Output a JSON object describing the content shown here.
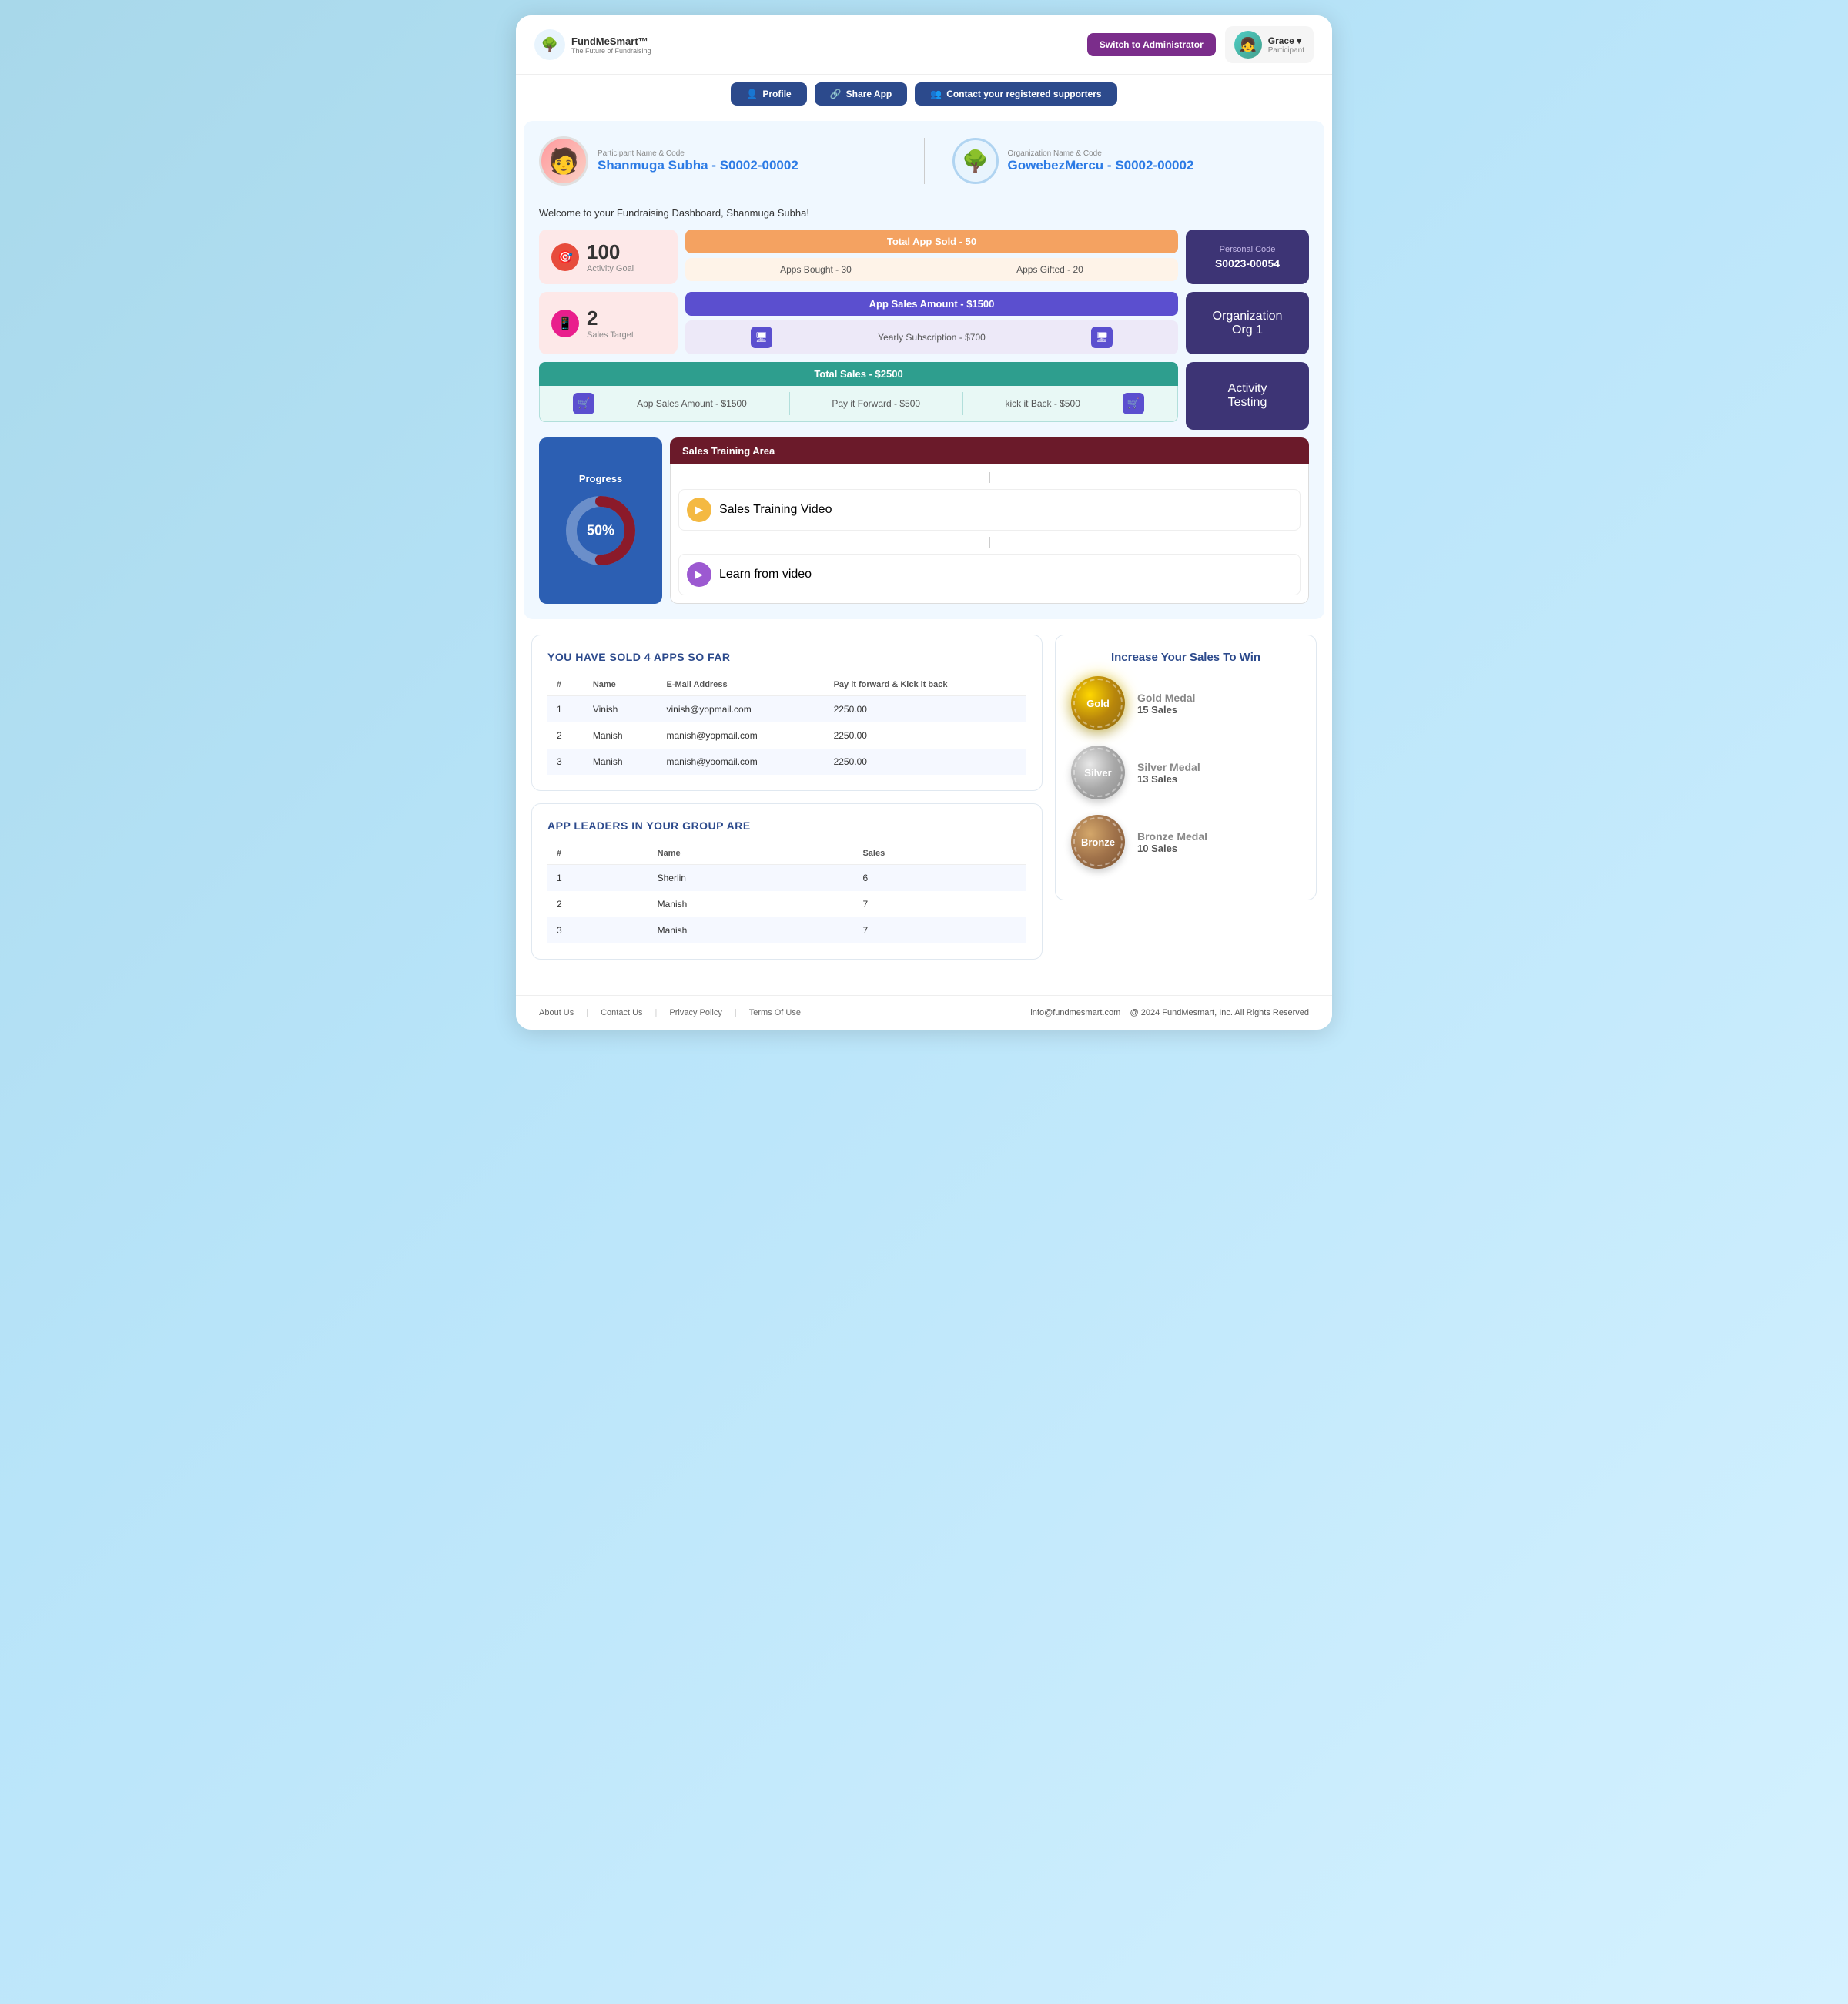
{
  "app": {
    "name": "FundMeSmart™",
    "tagline": "The Future of Fundraising"
  },
  "header": {
    "switch_btn": "Switch to Administrator",
    "user_name": "Grace",
    "user_chevron": "▾",
    "user_role": "Participant"
  },
  "nav": {
    "profile_label": "Profile",
    "share_label": "Share App",
    "contact_label": "Contact your registered supporters"
  },
  "participant": {
    "label": "Participant Name & Code",
    "name": "Shanmuga Subha",
    "code": "S0002-00002",
    "welcome": "Welcome to your Fundraising Dashboard, Shanmuga Subha!"
  },
  "org": {
    "label": "Organization Name & Code",
    "name": "GowebezMercu",
    "code": "S0002-00002"
  },
  "stats": {
    "activity_goal_number": "100",
    "activity_goal_label": "Activity Goal",
    "sales_target_number": "2",
    "sales_target_label": "Sales Target",
    "total_app_header": "Total App Sold - 50",
    "apps_bought": "Apps Bought - 30",
    "apps_gifted": "Apps Gifted - 20",
    "app_sales_header": "App Sales Amount - $1500",
    "yearly_subscription": "Yearly Subscription - $700",
    "total_sales_header": "Total Sales - $2500",
    "app_sales_amount": "App Sales Amount - $1500",
    "pay_it_forward": "Pay it Forward - $500",
    "kick_it_back": "kick it Back - $500",
    "personal_code_label": "Personal Code",
    "personal_code_value": "S0023-00054",
    "org_label": "Organization",
    "org_value": "Org 1",
    "activity_label": "Activity",
    "activity_value": "Testing"
  },
  "progress": {
    "label": "Progress",
    "percent": "50%"
  },
  "training": {
    "header": "Sales Training Area",
    "video1_label": "Sales Training Video",
    "video2_label": "Learn from video"
  },
  "sales_table": {
    "title": "YOU HAVE SOLD 4 APPS SO FAR",
    "columns": [
      "#",
      "Name",
      "E-Mail Address",
      "Pay it forward & Kick it back"
    ],
    "rows": [
      {
        "num": "1",
        "name": "Vinish",
        "email": "vinish@yopmail.com",
        "amount": "2250.00"
      },
      {
        "num": "2",
        "name": "Manish",
        "email": "manish@yopmail.com",
        "amount": "2250.00"
      },
      {
        "num": "3",
        "name": "Manish",
        "email": "manish@yoomail.com",
        "amount": "2250.00"
      }
    ]
  },
  "leaders_table": {
    "title": "APP LEADERS IN YOUR GROUP ARE",
    "columns": [
      "#",
      "Name",
      "Sales"
    ],
    "rows": [
      {
        "num": "1",
        "name": "Sherlin",
        "sales": "6"
      },
      {
        "num": "2",
        "name": "Manish",
        "sales": "7"
      },
      {
        "num": "3",
        "name": "Manish",
        "sales": "7"
      }
    ]
  },
  "medals": {
    "title": "Increase Your Sales To Win",
    "gold": {
      "label": "Gold",
      "name": "Gold Medal",
      "sales": "15 Sales"
    },
    "silver": {
      "label": "Silver",
      "name": "Silver Medal",
      "sales": "13 Sales"
    },
    "bronze": {
      "label": "Bronze",
      "name": "Bronze Medal",
      "sales": "10 Sales"
    }
  },
  "footer": {
    "about": "About Us",
    "contact": "Contact Us",
    "privacy": "Privacy Policy",
    "terms": "Terms Of Use",
    "email": "info@fundmesmart.com",
    "copyright": "@ 2024 FundMesmart, Inc.   All Rights Reserved"
  }
}
